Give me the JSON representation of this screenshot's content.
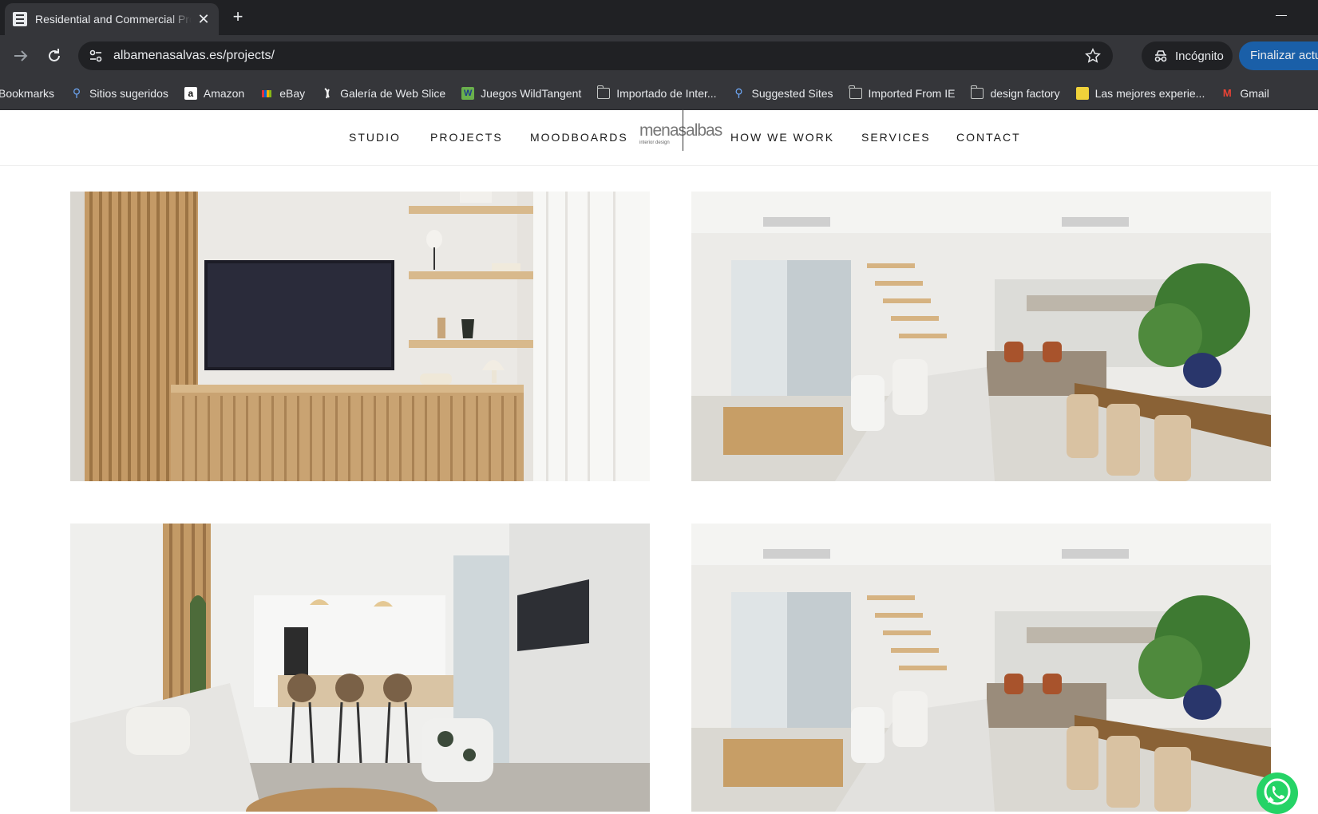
{
  "browser": {
    "tab_title": "Residential and Commercial Projects",
    "url": "albamenasalvas.es/projects/",
    "incognito_label": "Incógnito",
    "finalize_label": "Finalizar actualización",
    "new_tab_symbol": "+",
    "close_symbol": "✕",
    "bookmarks": [
      {
        "label": "Bookmarks",
        "icon": "none"
      },
      {
        "label": "Sitios sugeridos",
        "icon": "search-icon"
      },
      {
        "label": "Amazon",
        "icon": "amazon-icon"
      },
      {
        "label": "eBay",
        "icon": "ebay-icon"
      },
      {
        "label": "Galería de Web Slice",
        "icon": "web-slice-icon"
      },
      {
        "label": "Juegos WildTangent",
        "icon": "wildtangent-icon"
      },
      {
        "label": "Importado de Inter...",
        "icon": "folder-icon"
      },
      {
        "label": "Suggested Sites",
        "icon": "search-icon"
      },
      {
        "label": "Imported From IE",
        "icon": "folder-icon"
      },
      {
        "label": "design factory",
        "icon": "folder-icon"
      },
      {
        "label": "Las mejores experie...",
        "icon": "experiences-icon"
      },
      {
        "label": "Gmail",
        "icon": "gmail-icon"
      }
    ],
    "colors": {
      "frame": "#202124",
      "toolbar": "#35363a",
      "accent": "#1a5fa8"
    }
  },
  "site": {
    "nav": {
      "studio": "STUDIO",
      "projects": "PROJECTS",
      "moodboards": "MOODBOARDS",
      "how_we_work": "HOW WE WORK",
      "services": "SERVICES",
      "contact": "CONTACT"
    },
    "logo": {
      "text": "menasalbas",
      "subtitle": "interior design"
    },
    "projects": [
      {
        "scene": "living-room-tv-wall"
      },
      {
        "scene": "open-plan-living-dining"
      },
      {
        "scene": "living-kitchen"
      },
      {
        "scene": "open-plan-living-dining"
      }
    ],
    "whatsapp": {
      "icon": "whatsapp-icon",
      "color": "#25d366"
    }
  }
}
